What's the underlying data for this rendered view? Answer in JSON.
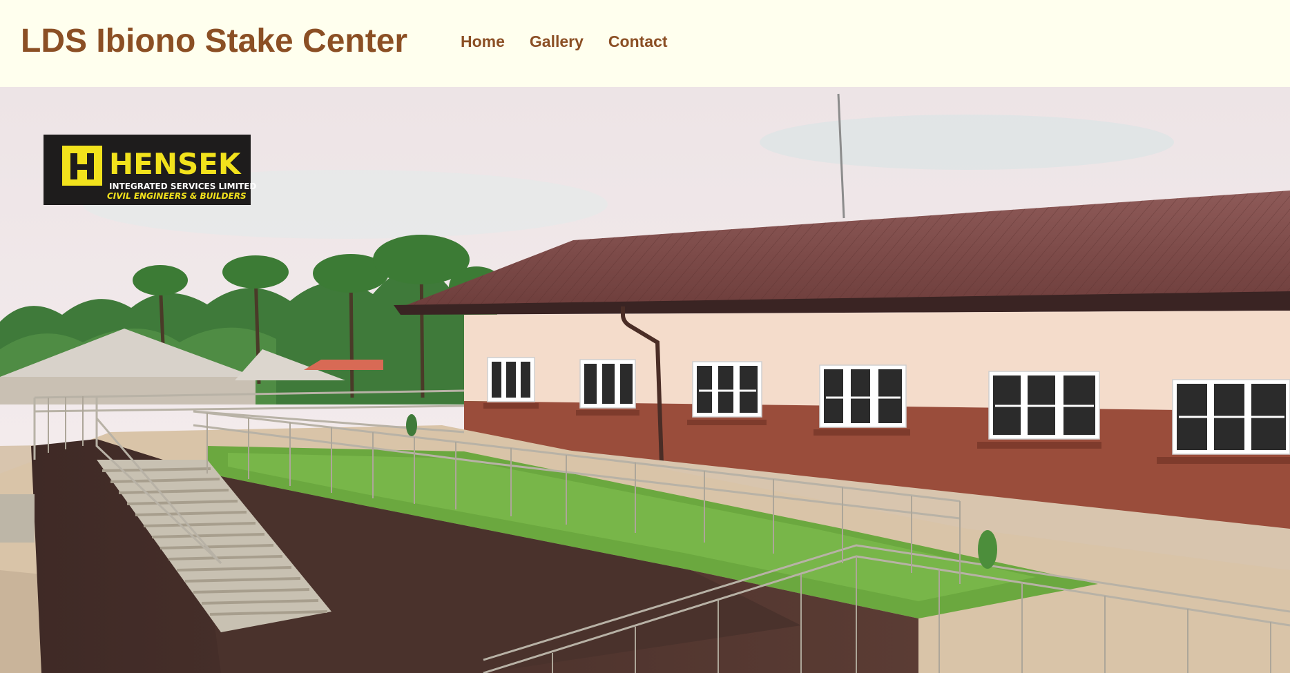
{
  "header": {
    "site_title": "LDS Ibiono Stake Center",
    "nav": [
      {
        "label": "Home"
      },
      {
        "label": "Gallery"
      },
      {
        "label": "Contact"
      }
    ]
  },
  "hero": {
    "logo": {
      "name": "HENSEK",
      "line1": "INTEGRATED SERVICES LIMITED",
      "line2": "CIVIL ENGINEERS & BUILDERS"
    }
  },
  "colors": {
    "header_bg": "#FFFFEE",
    "accent": "#8B4F24",
    "roof": "#7A4744",
    "wall_lower": "#9A4D3B",
    "wall_upper": "#F4DCCB"
  }
}
